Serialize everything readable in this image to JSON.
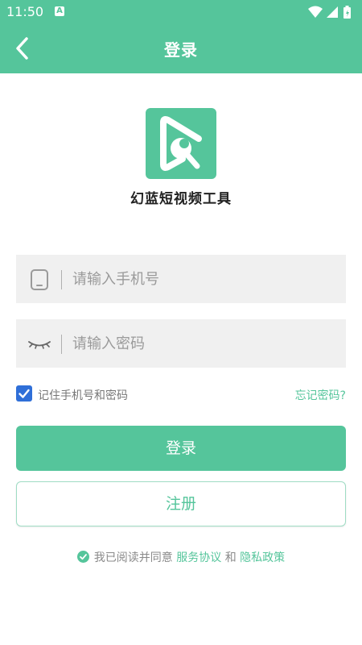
{
  "status_bar": {
    "time": "11:50",
    "notification_icon_letter": "A",
    "icons": [
      "wifi-icon",
      "signal-icon",
      "battery-icon"
    ]
  },
  "app_bar": {
    "title": "登录",
    "back_icon": "chevron-left-icon"
  },
  "app": {
    "name": "幻蓝短视频工具",
    "logo_icon": "logo-play-wrench-icon"
  },
  "form": {
    "phone_placeholder": "请输入手机号",
    "phone_value": "",
    "phone_icon": "phone-icon",
    "password_placeholder": "请输入密码",
    "password_value": "",
    "password_icon": "eye-closed-icon",
    "remember_label": "记住手机号和密码",
    "remember_checked": true,
    "forgot_password": "忘记密码?"
  },
  "buttons": {
    "login": "登录",
    "register": "注册"
  },
  "agreement": {
    "prefix": "我已阅读并同意",
    "service_link": "服务协议",
    "and": "和",
    "privacy_link": "隐私政策"
  },
  "colors": {
    "primary": "#55c59b",
    "checkbox": "#2f6fd8",
    "input_bg": "#f0f0f0"
  }
}
